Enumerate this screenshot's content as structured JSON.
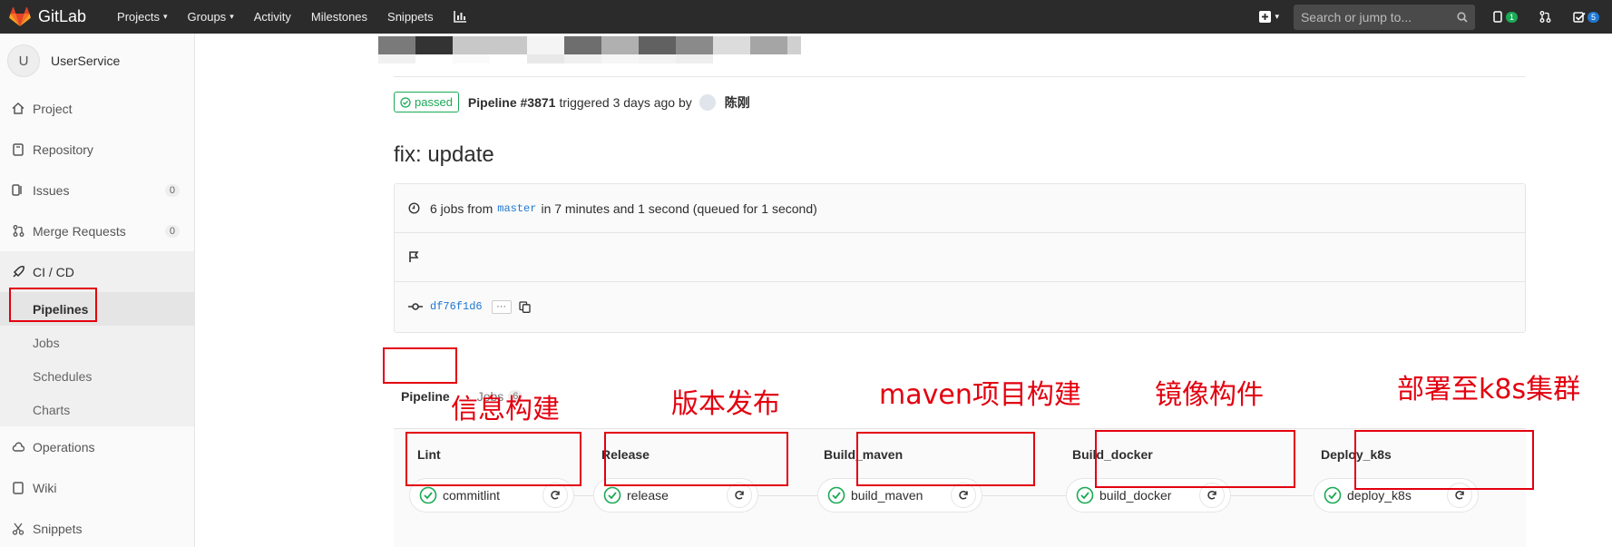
{
  "topnav": {
    "brand": "GitLab",
    "links": [
      {
        "label": "Projects",
        "dropdown": true
      },
      {
        "label": "Groups",
        "dropdown": true
      },
      {
        "label": "Activity",
        "dropdown": false
      },
      {
        "label": "Milestones",
        "dropdown": false
      },
      {
        "label": "Snippets",
        "dropdown": false
      }
    ],
    "search_placeholder": "Search or jump to...",
    "issues_count": "1",
    "todos_count": "5"
  },
  "sidebar": {
    "avatar_letter": "U",
    "project_name": "UserService",
    "items": [
      {
        "label": "Project",
        "icon": "home-icon"
      },
      {
        "label": "Repository",
        "icon": "book-icon"
      },
      {
        "label": "Issues",
        "icon": "issues-icon",
        "count": "0"
      },
      {
        "label": "Merge Requests",
        "icon": "merge-request-icon",
        "count": "0"
      },
      {
        "label": "CI / CD",
        "icon": "rocket-icon"
      }
    ],
    "cicd_sub": [
      "Pipelines",
      "Jobs",
      "Schedules",
      "Charts"
    ],
    "after": [
      {
        "label": "Operations",
        "icon": "cloud-icon"
      },
      {
        "label": "Wiki",
        "icon": "book-icon"
      },
      {
        "label": "Snippets",
        "icon": "snippet-icon"
      }
    ]
  },
  "pipeline": {
    "status": "passed",
    "id_label": "Pipeline #3871",
    "triggered_text": "triggered 3 days ago by",
    "user": "陈刚",
    "commit_title": "fix: update",
    "jobs_prefix": "6 jobs from",
    "branch": "master",
    "duration_text": "in 7 minutes and 1 second (queued for 1 second)",
    "sha": "df76f1d6",
    "ellipsis": "···"
  },
  "tabs": {
    "pipeline": "Pipeline",
    "jobs": "Jobs",
    "jobs_count": "6"
  },
  "stages": [
    {
      "name": "Lint",
      "job": "commitlint"
    },
    {
      "name": "Release",
      "job": "release"
    },
    {
      "name": "Build_maven",
      "job": "build_maven"
    },
    {
      "name": "Build_docker",
      "job": "build_docker"
    },
    {
      "name": "Deploy_k8s",
      "job": "deploy_k8s"
    }
  ],
  "annotations": [
    "信息构建",
    "版本发布",
    "maven项目构建",
    "镜像构件",
    "部署至k8s集群"
  ],
  "colors": {
    "success": "#1aaa55",
    "annotation": "#e3000f",
    "link": "#1f78d1",
    "nav_bg": "#2b2b2b"
  }
}
